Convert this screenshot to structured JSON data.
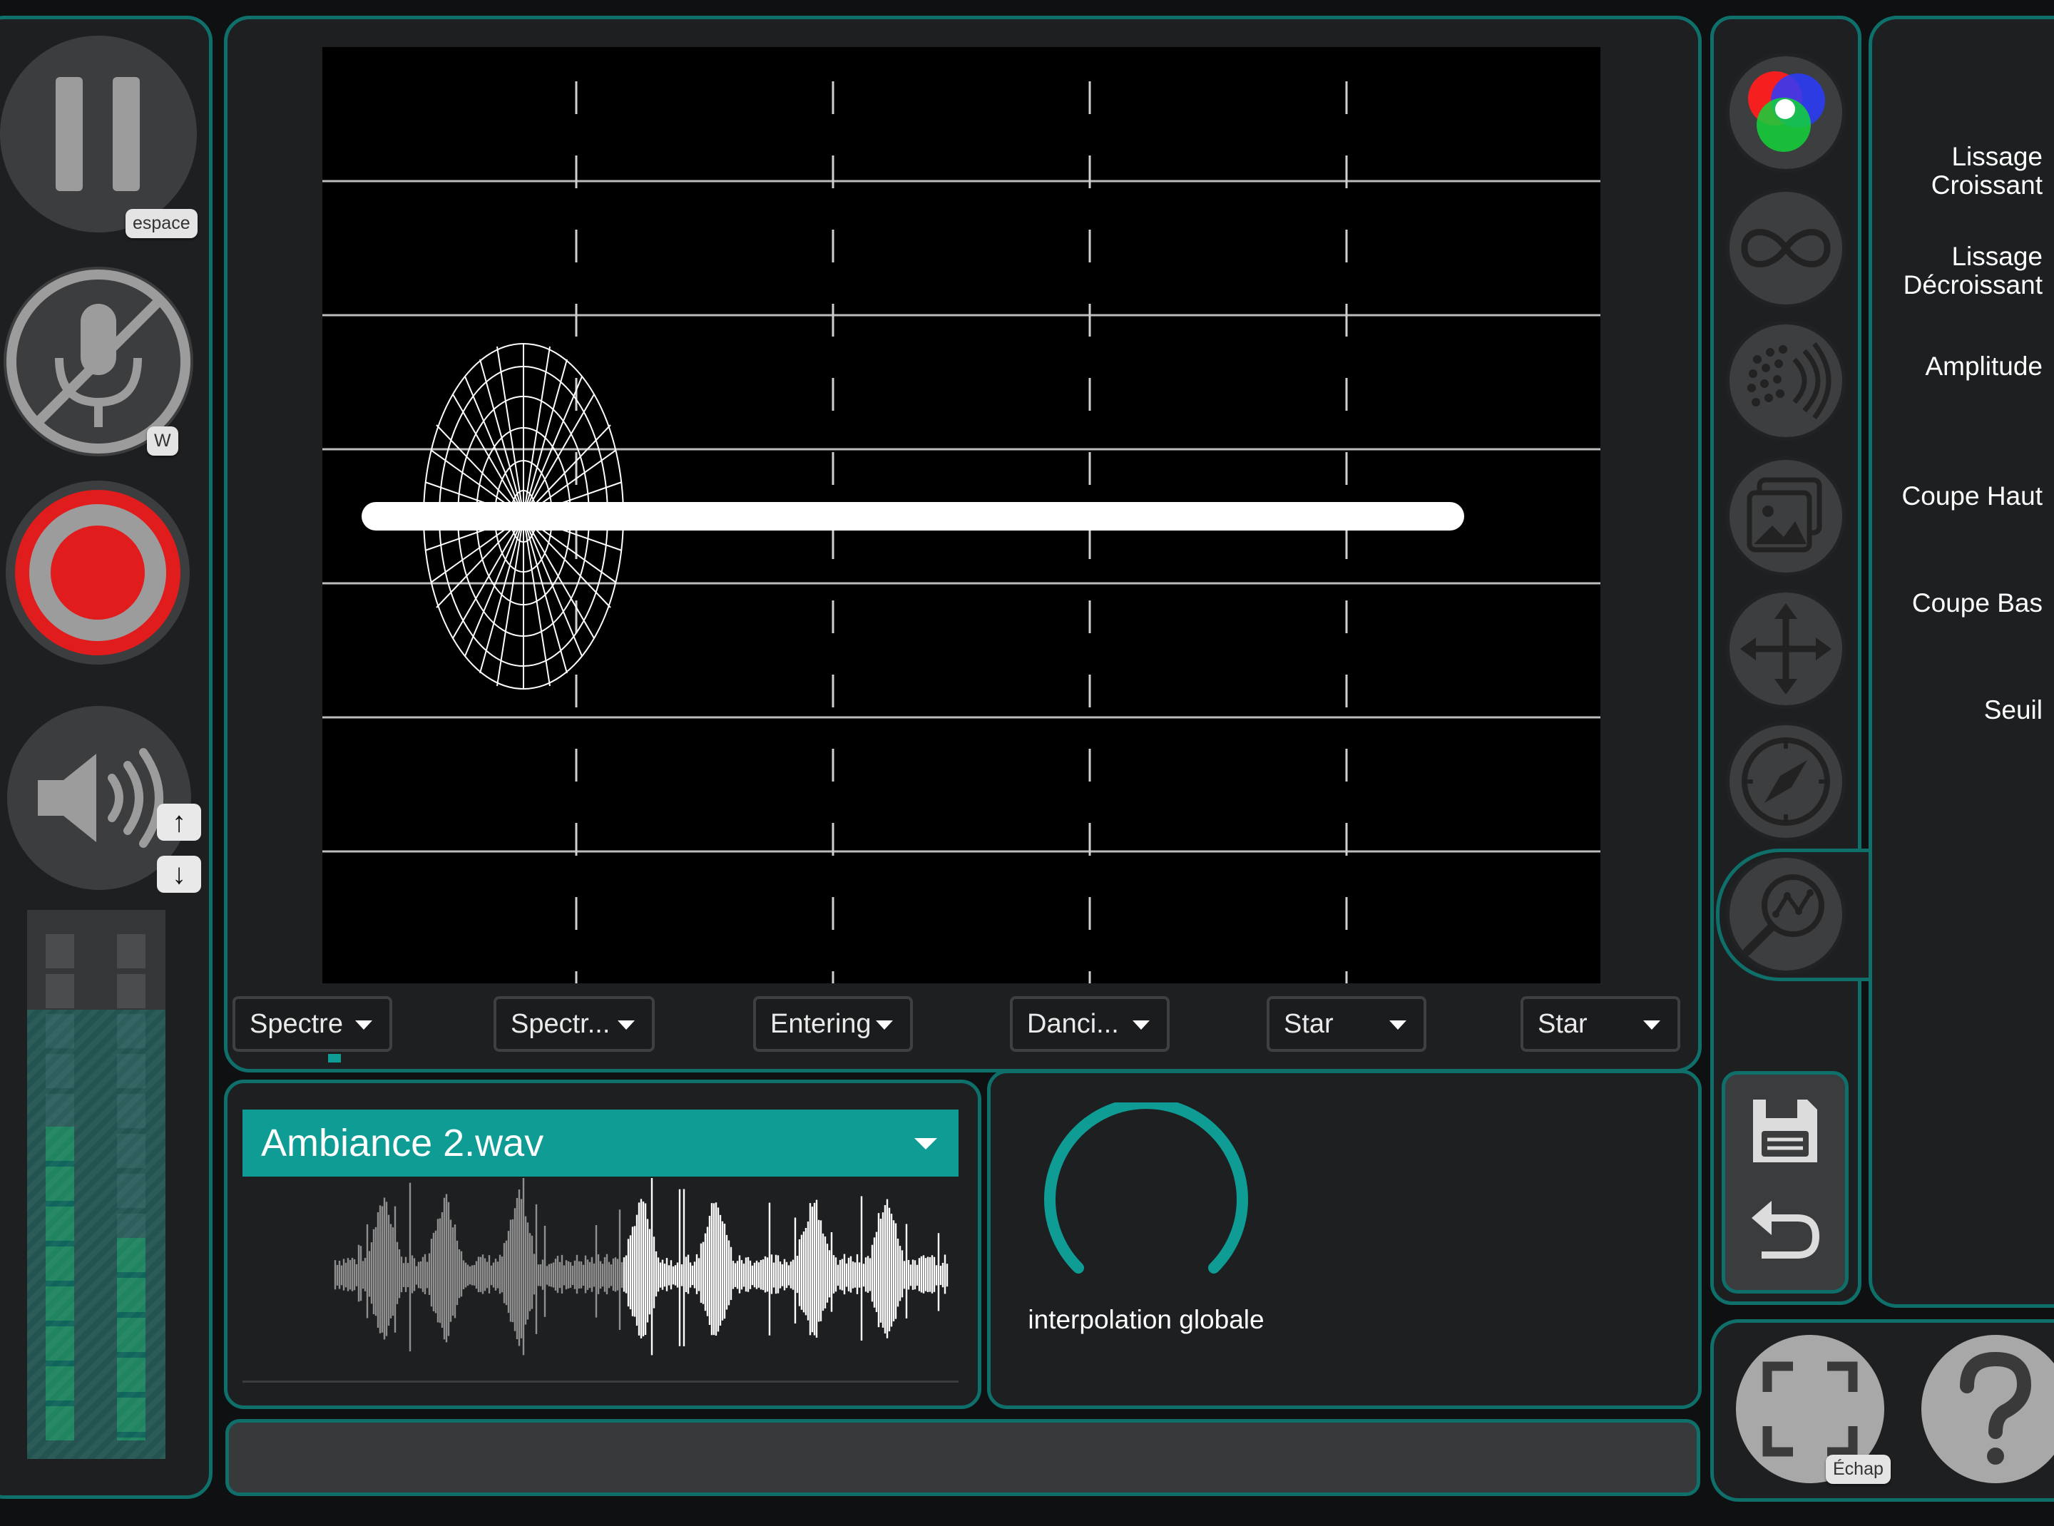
{
  "transport": {
    "play_pause_shortcut": "espace",
    "mic_shortcut": "W",
    "volume_up_key": "↑",
    "volume_down_key": "↓",
    "meter_levels": [
      0.62,
      0.4
    ]
  },
  "visualizer": {
    "dropdowns": [
      {
        "label": "Spectre"
      },
      {
        "label": "Spectr..."
      },
      {
        "label": "Entering"
      },
      {
        "label": "Danci..."
      },
      {
        "label": "Star"
      },
      {
        "label": "Star"
      }
    ]
  },
  "audio": {
    "file_name": "Ambiance 2.wav",
    "playback_progress": 0.47
  },
  "knob": {
    "label": "interpolation globale"
  },
  "tools": {
    "icons": [
      "color-wheel-icon",
      "infinity-icon",
      "particles-icon",
      "image-icon",
      "move-icon",
      "compass-icon",
      "analysis-icon"
    ],
    "save_icon": "save-icon",
    "undo_icon": "undo-icon"
  },
  "parameters": {
    "labels": [
      {
        "line1": "Lissage",
        "line2": "Croissant"
      },
      {
        "line1": "Lissage",
        "line2": "Décroissant"
      },
      {
        "line1": "Amplitude",
        "line2": ""
      },
      {
        "line1": "Coupe Haut",
        "line2": ""
      },
      {
        "line1": "Coupe Bas",
        "line2": ""
      },
      {
        "line1": "Seuil",
        "line2": ""
      }
    ]
  },
  "footer": {
    "fullscreen_shortcut": "Échap"
  },
  "colors": {
    "accent": "#0e9c94",
    "record": "#e11c1c",
    "panel": "#1d1f21"
  }
}
